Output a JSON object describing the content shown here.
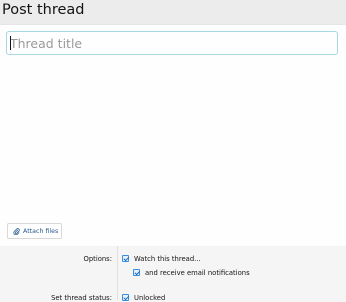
{
  "page": {
    "title": "Post thread"
  },
  "form": {
    "title_placeholder": "Thread title",
    "title_value": "",
    "attach_label": "Attach files"
  },
  "options": {
    "label": "Options:",
    "watch_label": "Watch this thread...",
    "watch_checked": true,
    "email_label": "and receive email notifications",
    "email_checked": true
  },
  "status": {
    "label": "Set thread status:",
    "unlocked_label": "Unlocked",
    "unlocked_checked": true
  },
  "icons": {
    "attach": "paperclip-icon"
  },
  "colors": {
    "accent": "#3b8fd6",
    "link": "#2b5a8f",
    "input_border": "#a7d7e1"
  }
}
